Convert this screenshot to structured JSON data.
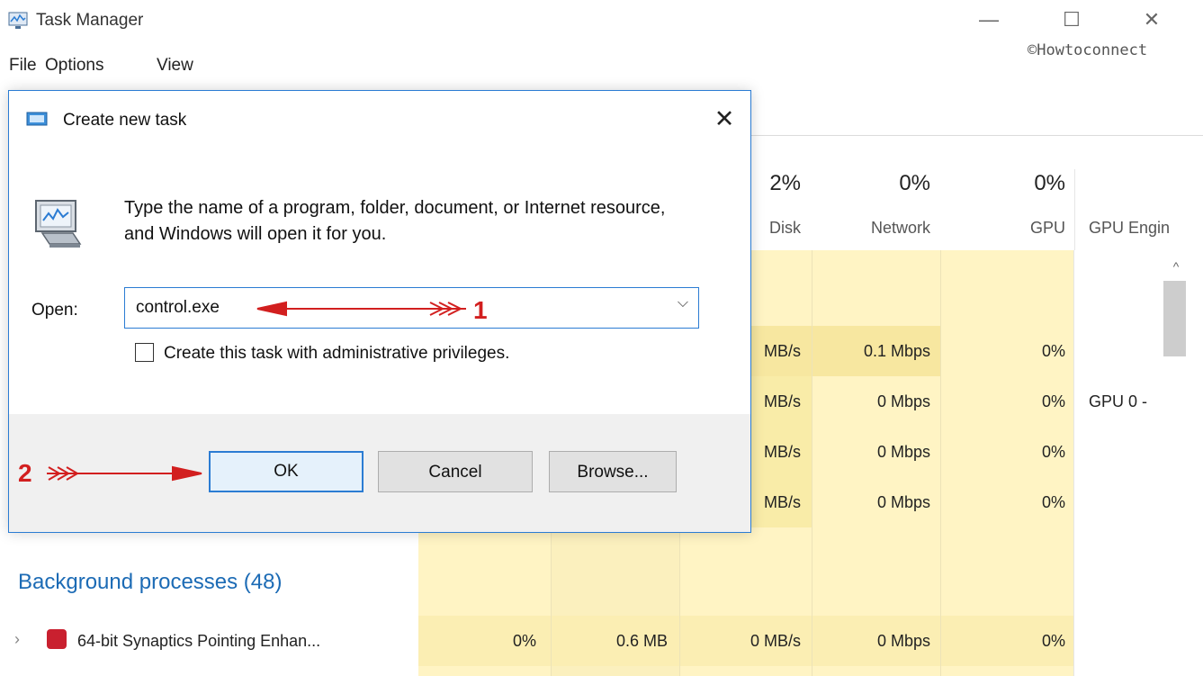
{
  "window": {
    "title": "Task Manager",
    "controls": {
      "minimize": "—",
      "maximize": "☐",
      "close": "✕"
    },
    "watermark": "©Howtoconnect"
  },
  "menu": {
    "items": [
      "File",
      "Options",
      "View"
    ]
  },
  "columns": [
    {
      "pct": "2%",
      "name": "Disk"
    },
    {
      "pct": "0%",
      "name": "Network"
    },
    {
      "pct": "0%",
      "name": "GPU"
    },
    {
      "pct": "",
      "name": "GPU Engin"
    }
  ],
  "rows": [
    {
      "disk": "MB/s",
      "network": "0.1 Mbps",
      "gpu": "0%",
      "gpu_engine": ""
    },
    {
      "disk": "MB/s",
      "network": "0 Mbps",
      "gpu": "0%",
      "gpu_engine": "GPU 0 -"
    },
    {
      "disk": "MB/s",
      "network": "0 Mbps",
      "gpu": "0%",
      "gpu_engine": ""
    },
    {
      "disk": "MB/s",
      "network": "0 Mbps",
      "gpu": "0%",
      "gpu_engine": ""
    }
  ],
  "background": {
    "heading": "Background processes (48)",
    "row": {
      "expand": "›",
      "name": "64-bit Synaptics Pointing Enhan...",
      "cpu": "0%",
      "memory": "0.6 MB",
      "disk": "0 MB/s",
      "network": "0 Mbps",
      "gpu": "0%"
    }
  },
  "dialog": {
    "title": "Create new task",
    "close": "✕",
    "description": "Type the name of a program, folder, document, or Internet resource, and Windows will open it for you.",
    "open_label": "Open:",
    "open_value": "control.exe",
    "dropdown_arrow": "⌵",
    "admin_label": "Create this task with administrative privileges.",
    "admin_checked": false,
    "buttons": {
      "ok": "OK",
      "cancel": "Cancel",
      "browse": "Browse..."
    }
  },
  "annotations": {
    "step1": "1",
    "step2": "2",
    "color": "#d21f1f"
  },
  "colors": {
    "accent": "#2b7cd3",
    "highlight": "#fff4c4",
    "heading": "#1c6bb5"
  }
}
